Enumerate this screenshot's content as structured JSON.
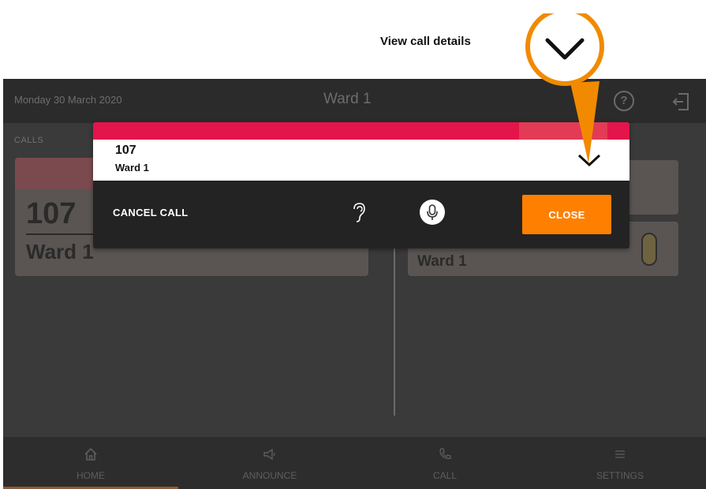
{
  "annotation": {
    "label": "View call details"
  },
  "topbar": {
    "date": "Monday 30 March 2020",
    "title": "Ward 1",
    "help_label": "?"
  },
  "calls": {
    "section_label": "CALLS",
    "card_left": {
      "number": "107",
      "ward": "Ward 1"
    },
    "card_right_2": {
      "ward": "Ward 1"
    }
  },
  "modal": {
    "number": "107",
    "ward": "Ward 1",
    "cancel_label": "CANCEL CALL",
    "close_label": "CLOSE",
    "colors": {
      "strip": "#e3154a",
      "close": "#ff8000"
    }
  },
  "nav": {
    "items": [
      {
        "label": "HOME",
        "icon": "home-icon"
      },
      {
        "label": "ANNOUNCE",
        "icon": "megaphone-icon"
      },
      {
        "label": "CALL",
        "icon": "phone-icon"
      },
      {
        "label": "SETTINGS",
        "icon": "menu-icon"
      }
    ]
  }
}
